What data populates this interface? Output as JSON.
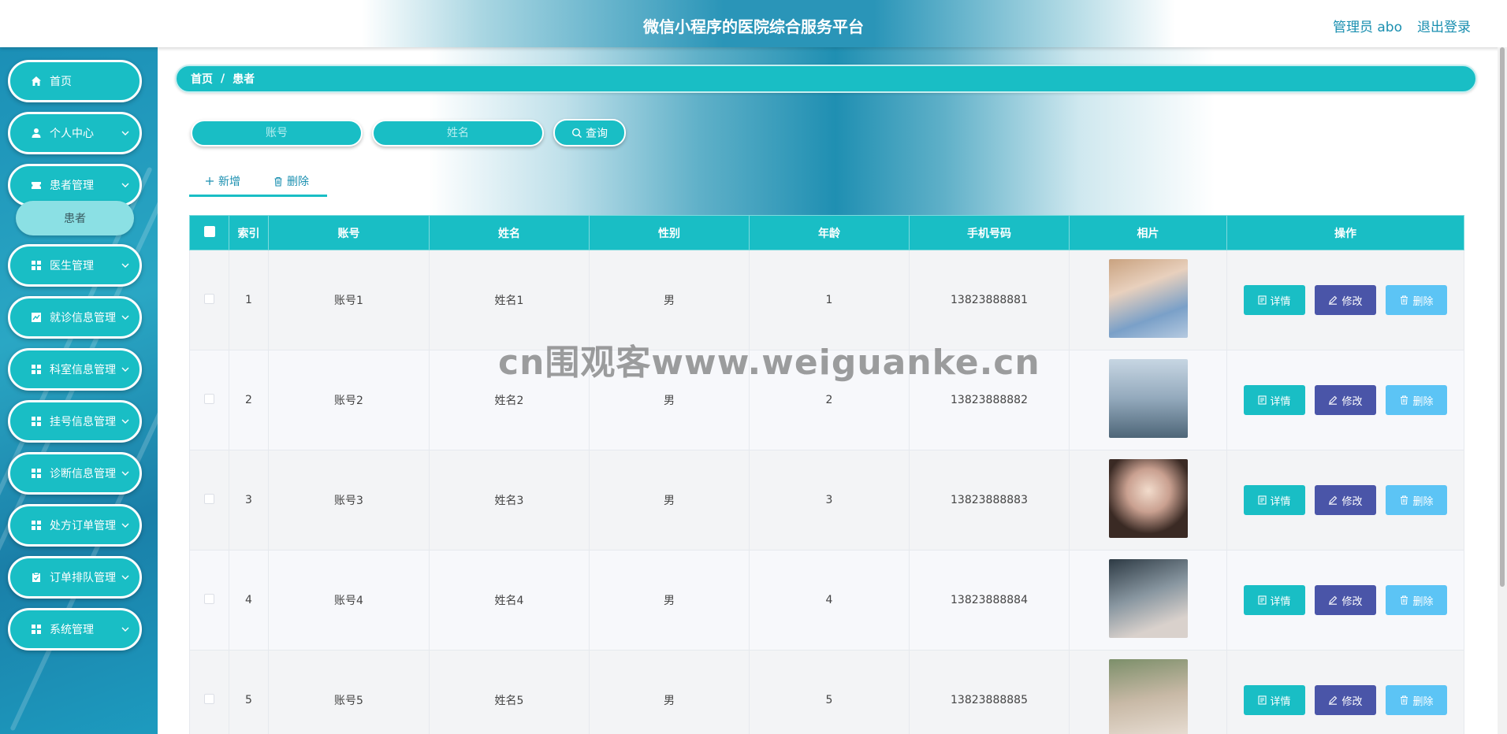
{
  "header": {
    "title": "微信小程序的医院综合服务平台",
    "user_label": "管理员 abo",
    "logout_label": "退出登录"
  },
  "sidebar": {
    "items": [
      {
        "label": "首页",
        "icon": "home-icon"
      },
      {
        "label": "个人中心",
        "icon": "user-icon"
      },
      {
        "label": "患者管理",
        "icon": "ticket-icon"
      },
      {
        "label": "医生管理",
        "icon": "grid-icon"
      },
      {
        "label": "就诊信息管理",
        "icon": "chart-icon"
      },
      {
        "label": "科室信息管理",
        "icon": "grid-icon"
      },
      {
        "label": "挂号信息管理",
        "icon": "grid-icon"
      },
      {
        "label": "诊断信息管理",
        "icon": "grid-icon"
      },
      {
        "label": "处方订单管理",
        "icon": "grid-icon"
      },
      {
        "label": "订单排队管理",
        "icon": "clipboard-icon"
      },
      {
        "label": "系统管理",
        "icon": "grid-icon"
      }
    ],
    "submenu": {
      "label": "患者"
    }
  },
  "breadcrumb": {
    "home": "首页",
    "sep": "/",
    "current": "患者"
  },
  "search": {
    "account_placeholder": "账号",
    "name_placeholder": "姓名",
    "button_label": "查询"
  },
  "actions": {
    "add_label": "新增",
    "delete_label": "删除"
  },
  "table": {
    "headers": [
      "索引",
      "账号",
      "姓名",
      "性别",
      "年龄",
      "手机号码",
      "相片",
      "操作"
    ],
    "rows": [
      {
        "index": "1",
        "account": "账号1",
        "name": "姓名1",
        "gender": "男",
        "age": "1",
        "phone": "13823888881"
      },
      {
        "index": "2",
        "account": "账号2",
        "name": "姓名2",
        "gender": "男",
        "age": "2",
        "phone": "13823888882"
      },
      {
        "index": "3",
        "account": "账号3",
        "name": "姓名3",
        "gender": "男",
        "age": "3",
        "phone": "13823888883"
      },
      {
        "index": "4",
        "account": "账号4",
        "name": "姓名4",
        "gender": "男",
        "age": "4",
        "phone": "13823888884"
      },
      {
        "index": "5",
        "account": "账号5",
        "name": "姓名5",
        "gender": "男",
        "age": "5",
        "phone": "13823888885"
      }
    ],
    "row_buttons": {
      "detail": "详情",
      "edit": "修改",
      "delete": "删除"
    }
  },
  "watermark": "cn围观客www.weiguanke.cn",
  "colors": {
    "accent": "#19bec5",
    "edit": "#4a55a8",
    "delete": "#5cc4f5",
    "sidebar": "#1b8fb6"
  }
}
